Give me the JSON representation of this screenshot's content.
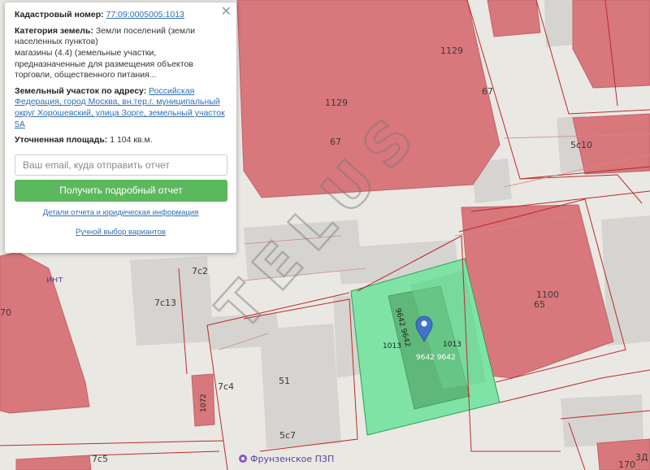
{
  "popup": {
    "close_label": "✕",
    "cadastral_label": "Кадастровый номер:",
    "cadastral_number": "77:09:0005005:1013",
    "category_label": "Категория земель:",
    "category_value": "Земли поселений (земли населенных пунктов)",
    "use_text": "магазины (4.4) (земельные участки, предназначенные для размещения объектов торговли, общественного питания...",
    "address_label": "Земельный участок по адресу:",
    "address_value": "Российская Федерация, город Москва, вн.тер.г. муниципальный округ Хорошевский, улица Зорге, земельный участок 5А",
    "area_label": "Уточненная площадь:",
    "area_value": "1 104 кв.м.",
    "email_placeholder": "Ваш email, куда отправить отчет",
    "report_button": "Получить подробный отчет",
    "details_link": "Детали отчета и юридическая информация",
    "manual_link": "Ручной выбор вариантов"
  },
  "map": {
    "labels": {
      "b1129_a": "1129",
      "b1129_b": "1129",
      "b67_a": "67",
      "b67_b": "67",
      "b5c10": "5с10",
      "b1100": "1100",
      "b65": "65",
      "b7c2": "7с2",
      "b7c13": "7с13",
      "b7c4": "7с4",
      "b51": "51",
      "b5c7": "5с7",
      "b7c5": "7с5",
      "b170": "170",
      "b3d": "3Д",
      "b70": "70",
      "bint": "инт",
      "b1072": "1072",
      "p1013_left": "1013",
      "p1013_right": "1013",
      "p9642_vert": "9642 9642",
      "p9642_horz": "9642 9642",
      "watermark": "TELUS",
      "poi": "Фрунзенское ПЗП"
    },
    "colors": {
      "building": "#d8777c",
      "building_edge": "#c26368",
      "highlight": "#7fe3a6",
      "highlight_inner": "#5fb87a",
      "marker": "#3f73c6",
      "road": "#c42828"
    }
  }
}
